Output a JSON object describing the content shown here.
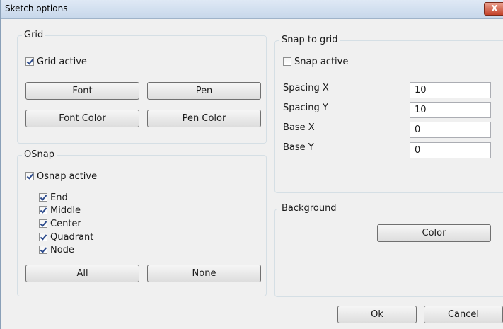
{
  "window": {
    "title": "Sketch options",
    "close_label": "X"
  },
  "grid": {
    "title": "Grid",
    "active_label": "Grid active",
    "active_checked": true,
    "font_button": "Font",
    "pen_button": "Pen",
    "font_color_button": "Font Color",
    "pen_color_button": "Pen Color"
  },
  "osnap": {
    "title": "OSnap",
    "active_label": "Osnap active",
    "active_checked": true,
    "items": [
      {
        "label": "End",
        "checked": true
      },
      {
        "label": "Middle",
        "checked": true
      },
      {
        "label": "Center",
        "checked": true
      },
      {
        "label": "Quadrant",
        "checked": true
      },
      {
        "label": "Node",
        "checked": true
      }
    ],
    "all_button": "All",
    "none_button": "None"
  },
  "snap": {
    "title": "Snap to grid",
    "active_label": "Snap active",
    "active_checked": false,
    "spacing_x_label": "Spacing X",
    "spacing_x_value": "10",
    "spacing_y_label": "Spacing Y",
    "spacing_y_value": "10",
    "base_x_label": "Base X",
    "base_x_value": "0",
    "base_y_label": "Base Y",
    "base_y_value": "0"
  },
  "background": {
    "title": "Background",
    "color_button": "Color"
  },
  "footer": {
    "ok_button": "Ok",
    "cancel_button": "Cancel"
  }
}
